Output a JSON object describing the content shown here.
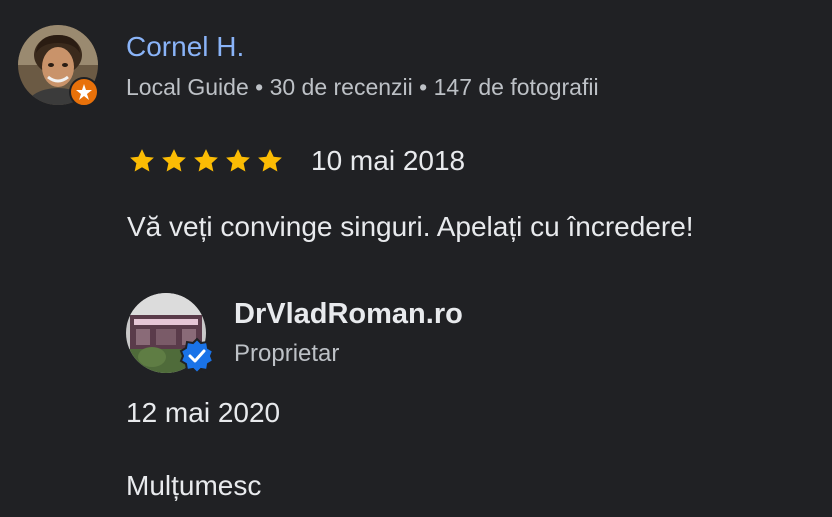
{
  "review": {
    "reviewer": {
      "name": "Cornel H.",
      "meta": "Local Guide • 30 de recenzii • 147 de fotografii",
      "avatar_icon": "person-photo-icon",
      "badge_icon": "local-guide-star-icon"
    },
    "rating": 5,
    "rating_max": 5,
    "date": "10 mai 2018",
    "text": "Vă veți convinge singuri. Apelați cu încredere!",
    "colors": {
      "background": "#202124",
      "name": "#8ab4f8",
      "star": "#fbbc04",
      "badge": "#e8710a",
      "verified": "#1a73e8"
    }
  },
  "owner_reply": {
    "name": "DrVladRoman.ro",
    "role": "Proprietar",
    "date": "12 mai 2020",
    "text": "Mulțumesc",
    "avatar_icon": "storefront-photo-icon",
    "verified_icon": "verified-check-icon"
  }
}
